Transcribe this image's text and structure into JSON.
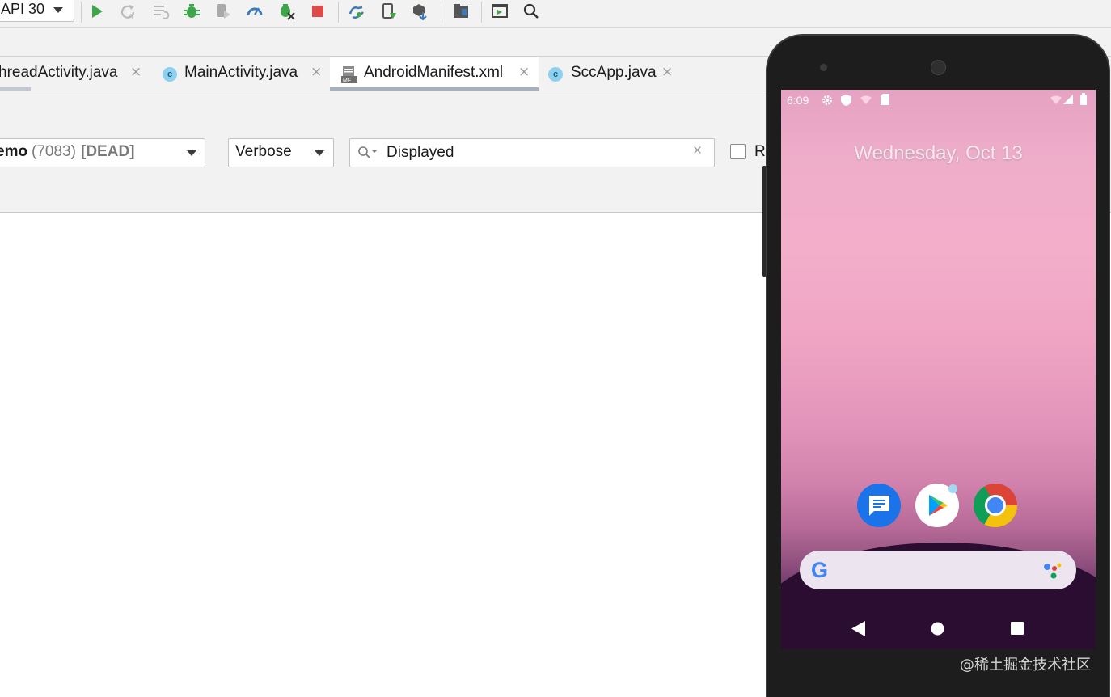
{
  "toolbar": {
    "device_label": "API 30",
    "icons": [
      "run-icon",
      "apply-changes-icon",
      "apply-code-changes-icon",
      "debug-icon",
      "attach-debugger-icon",
      "profile-icon",
      "debug-bug-icon",
      "stop-icon",
      "sync-gradle-icon",
      "device-manager-icon",
      "sdk-manager-icon",
      "project-structure-icon",
      "layout-inspector-icon",
      "search-icon"
    ]
  },
  "tabs": [
    {
      "label": "hreadActivity.java",
      "close": "×"
    },
    {
      "label": "MainActivity.java",
      "badge": "c",
      "close": "×"
    },
    {
      "label": "AndroidManifest.xml",
      "close": "×",
      "active": true
    },
    {
      "label": "SccApp.java",
      "badge": "c",
      "close": "×"
    }
  ],
  "logcat": {
    "process_name": "emo",
    "process_pid": "(7083)",
    "process_state": "[DEAD]",
    "level": "Verbose",
    "search_value": "Displayed",
    "clear_glyph": "×",
    "regex_label": "Re"
  },
  "phone": {
    "time": "6:09",
    "date": "Wednesday, Oct 13",
    "search_logo": "G",
    "apps": [
      "messages-app",
      "play-store-app",
      "chrome-app"
    ]
  },
  "watermark": "@稀土掘金技术社区",
  "colors": {
    "toolbar_bg": "#f2f2f2",
    "run_green": "#3ea54a",
    "stop_red": "#dd4a48",
    "accent_blue": "#1a73e8"
  }
}
